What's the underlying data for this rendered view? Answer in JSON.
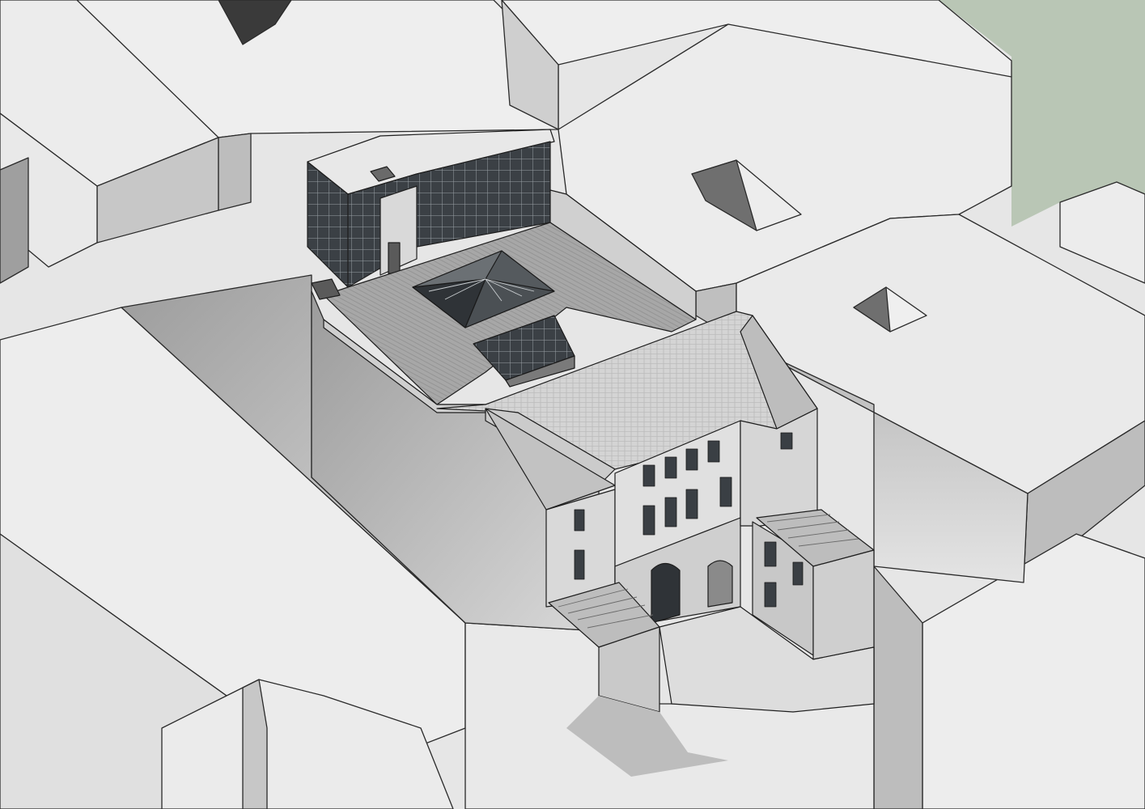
{
  "scene": {
    "view": "axonometric",
    "colors": {
      "background": "#ffffff",
      "roof_light": "#ececec",
      "wall_mid": "#c9c9c9",
      "wall_shadow": "#9e9e9e",
      "deep_shadow": "#6e6e6e",
      "green_background": "#b9c6b5",
      "ink": "#2a2a2a",
      "glass_dark": "#3a3f44",
      "deck_wood": "#9a9a9a",
      "tile_roof": "#d2d2d2"
    },
    "objects": [
      "surrounding-buildings",
      "modern-glazed-building",
      "roof-terrace",
      "glass-pyramid-skylight",
      "glass-lean-to-skylight",
      "tiled-hip-roof",
      "historic-facade-courtyard",
      "courtyard-canopy-left",
      "courtyard-canopy-right",
      "courtyard-ground"
    ]
  }
}
